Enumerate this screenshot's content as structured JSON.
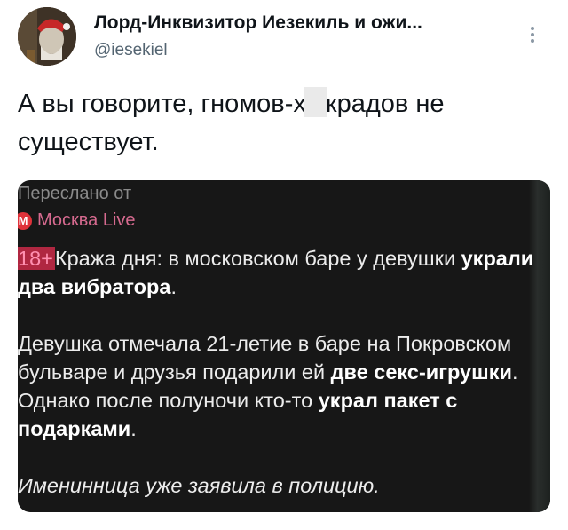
{
  "author": {
    "display_name": "Лорд-Инквизитор Иезекиль и ожи...",
    "handle": "@iesekiel"
  },
  "tweet": {
    "text_before": "А вы говорите, гномов-х",
    "text_after": "крадов не существует."
  },
  "media": {
    "forwarded_label": "Переслано от",
    "channel_name": "Москва Live",
    "channel_logo": "M",
    "age_badge": "18+",
    "title_plain": "Кража дня: в московском баре у девушки ",
    "title_bold": "украли два вибратора",
    "title_end": ".",
    "p1_a": "Девушка отмечала 21-летие в баре на Покровском бульваре и друзья подарили ей ",
    "p1_b": "две секс-игрушки",
    "p1_c": ". Однако после полуночи кто-то ",
    "p1_d": "украл пакет с подарками",
    "p1_e": ".",
    "p2": "Именинница уже заявила в полицию."
  },
  "icons": {
    "more": "more-vertical-icon"
  }
}
